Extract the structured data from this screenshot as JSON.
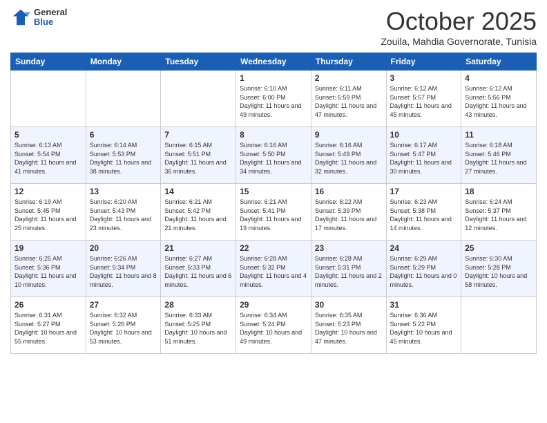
{
  "header": {
    "logo_general": "General",
    "logo_blue": "Blue",
    "month": "October 2025",
    "location": "Zouila, Mahdia Governorate, Tunisia"
  },
  "days_of_week": [
    "Sunday",
    "Monday",
    "Tuesday",
    "Wednesday",
    "Thursday",
    "Friday",
    "Saturday"
  ],
  "weeks": [
    [
      {
        "day": "",
        "info": ""
      },
      {
        "day": "",
        "info": ""
      },
      {
        "day": "",
        "info": ""
      },
      {
        "day": "1",
        "info": "Sunrise: 6:10 AM\nSunset: 6:00 PM\nDaylight: 11 hours and 49 minutes."
      },
      {
        "day": "2",
        "info": "Sunrise: 6:11 AM\nSunset: 5:59 PM\nDaylight: 11 hours and 47 minutes."
      },
      {
        "day": "3",
        "info": "Sunrise: 6:12 AM\nSunset: 5:57 PM\nDaylight: 11 hours and 45 minutes."
      },
      {
        "day": "4",
        "info": "Sunrise: 6:12 AM\nSunset: 5:56 PM\nDaylight: 11 hours and 43 minutes."
      }
    ],
    [
      {
        "day": "5",
        "info": "Sunrise: 6:13 AM\nSunset: 5:54 PM\nDaylight: 11 hours and 41 minutes."
      },
      {
        "day": "6",
        "info": "Sunrise: 6:14 AM\nSunset: 5:53 PM\nDaylight: 11 hours and 38 minutes."
      },
      {
        "day": "7",
        "info": "Sunrise: 6:15 AM\nSunset: 5:51 PM\nDaylight: 11 hours and 36 minutes."
      },
      {
        "day": "8",
        "info": "Sunrise: 6:16 AM\nSunset: 5:50 PM\nDaylight: 11 hours and 34 minutes."
      },
      {
        "day": "9",
        "info": "Sunrise: 6:16 AM\nSunset: 5:49 PM\nDaylight: 11 hours and 32 minutes."
      },
      {
        "day": "10",
        "info": "Sunrise: 6:17 AM\nSunset: 5:47 PM\nDaylight: 11 hours and 30 minutes."
      },
      {
        "day": "11",
        "info": "Sunrise: 6:18 AM\nSunset: 5:46 PM\nDaylight: 11 hours and 27 minutes."
      }
    ],
    [
      {
        "day": "12",
        "info": "Sunrise: 6:19 AM\nSunset: 5:45 PM\nDaylight: 11 hours and 25 minutes."
      },
      {
        "day": "13",
        "info": "Sunrise: 6:20 AM\nSunset: 5:43 PM\nDaylight: 11 hours and 23 minutes."
      },
      {
        "day": "14",
        "info": "Sunrise: 6:21 AM\nSunset: 5:42 PM\nDaylight: 11 hours and 21 minutes."
      },
      {
        "day": "15",
        "info": "Sunrise: 6:21 AM\nSunset: 5:41 PM\nDaylight: 11 hours and 19 minutes."
      },
      {
        "day": "16",
        "info": "Sunrise: 6:22 AM\nSunset: 5:39 PM\nDaylight: 11 hours and 17 minutes."
      },
      {
        "day": "17",
        "info": "Sunrise: 6:23 AM\nSunset: 5:38 PM\nDaylight: 11 hours and 14 minutes."
      },
      {
        "day": "18",
        "info": "Sunrise: 6:24 AM\nSunset: 5:37 PM\nDaylight: 11 hours and 12 minutes."
      }
    ],
    [
      {
        "day": "19",
        "info": "Sunrise: 6:25 AM\nSunset: 5:36 PM\nDaylight: 11 hours and 10 minutes."
      },
      {
        "day": "20",
        "info": "Sunrise: 6:26 AM\nSunset: 5:34 PM\nDaylight: 11 hours and 8 minutes."
      },
      {
        "day": "21",
        "info": "Sunrise: 6:27 AM\nSunset: 5:33 PM\nDaylight: 11 hours and 6 minutes."
      },
      {
        "day": "22",
        "info": "Sunrise: 6:28 AM\nSunset: 5:32 PM\nDaylight: 11 hours and 4 minutes."
      },
      {
        "day": "23",
        "info": "Sunrise: 6:28 AM\nSunset: 5:31 PM\nDaylight: 11 hours and 2 minutes."
      },
      {
        "day": "24",
        "info": "Sunrise: 6:29 AM\nSunset: 5:29 PM\nDaylight: 11 hours and 0 minutes."
      },
      {
        "day": "25",
        "info": "Sunrise: 6:30 AM\nSunset: 5:28 PM\nDaylight: 10 hours and 58 minutes."
      }
    ],
    [
      {
        "day": "26",
        "info": "Sunrise: 6:31 AM\nSunset: 5:27 PM\nDaylight: 10 hours and 55 minutes."
      },
      {
        "day": "27",
        "info": "Sunrise: 6:32 AM\nSunset: 5:26 PM\nDaylight: 10 hours and 53 minutes."
      },
      {
        "day": "28",
        "info": "Sunrise: 6:33 AM\nSunset: 5:25 PM\nDaylight: 10 hours and 51 minutes."
      },
      {
        "day": "29",
        "info": "Sunrise: 6:34 AM\nSunset: 5:24 PM\nDaylight: 10 hours and 49 minutes."
      },
      {
        "day": "30",
        "info": "Sunrise: 6:35 AM\nSunset: 5:23 PM\nDaylight: 10 hours and 47 minutes."
      },
      {
        "day": "31",
        "info": "Sunrise: 6:36 AM\nSunset: 5:22 PM\nDaylight: 10 hours and 45 minutes."
      },
      {
        "day": "",
        "info": ""
      }
    ]
  ]
}
